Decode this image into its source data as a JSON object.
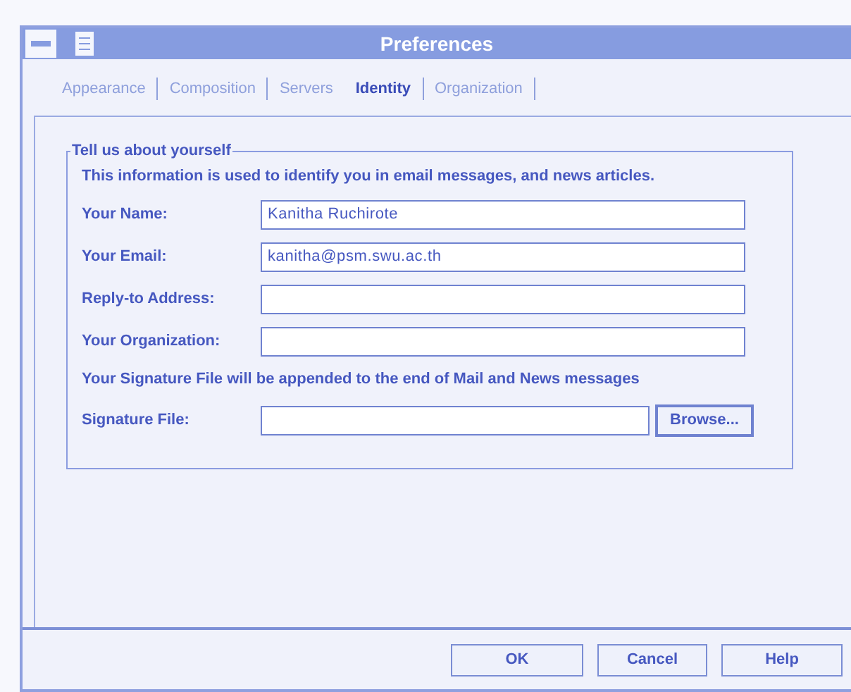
{
  "window": {
    "title": "Preferences"
  },
  "tabs": [
    {
      "label": "Appearance",
      "selected": false
    },
    {
      "label": "Composition",
      "selected": false
    },
    {
      "label": "Servers",
      "selected": false
    },
    {
      "label": "Identity",
      "selected": true
    },
    {
      "label": "Organization",
      "selected": false
    }
  ],
  "group": {
    "title": "Tell us about yourself",
    "intro": "This information is used to identify you in email messages, and news articles.",
    "fields": [
      {
        "label": "Your Name:",
        "value": "Kanitha Ruchirote"
      },
      {
        "label": "Your Email:",
        "value": "kanitha@psm.swu.ac.th"
      },
      {
        "label": "Reply-to Address:"
      },
      {
        "label": "Your Organization:"
      }
    ],
    "signature_note": "Your Signature File will be appended to the end of Mail and News messages",
    "signature_field": {
      "label": "Signature File:"
    },
    "browse_button": "Browse..."
  },
  "buttons": [
    "OK",
    "Cancel",
    "Help"
  ]
}
